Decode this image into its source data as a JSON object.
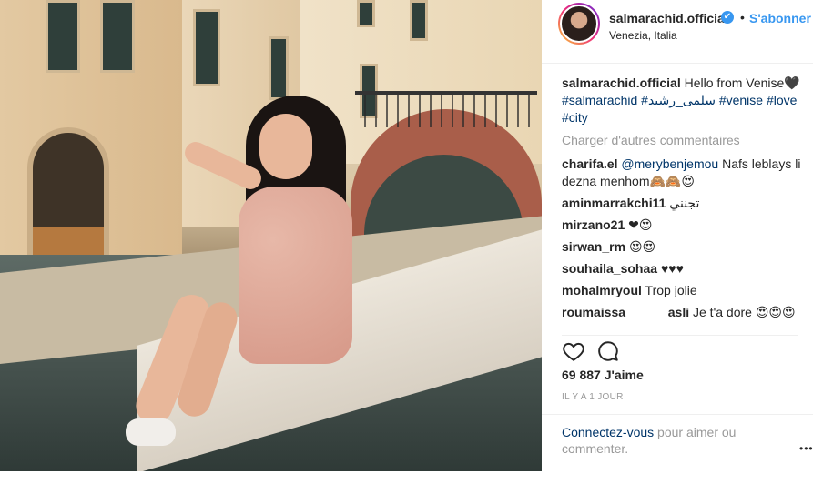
{
  "post": {
    "username": "salmarachid.official",
    "verified_glyph": "✔",
    "separator": "•",
    "follow_label": "S'abonner",
    "location": "Venezia, Italia"
  },
  "caption": {
    "username": "salmarachid.official",
    "text": "Hello from Venise",
    "emoji": "🖤",
    "hashtags": [
      "#salmarachid",
      "#سلمى_رشيد",
      "#venise",
      "#love",
      "#city"
    ]
  },
  "load_more_label": "Charger d'autres commentaires",
  "comments": [
    {
      "user": "charifa.el",
      "mention": "@merybenjemou",
      "text": "Nafs leblays li dezna menhom🙈🙈😍"
    },
    {
      "user": "aminmarrakchi11",
      "mention": "",
      "text": "تجنني"
    },
    {
      "user": "mirzano21",
      "mention": "",
      "text": "❤😍"
    },
    {
      "user": "sirwan_rm",
      "mention": "",
      "text": "😍😍"
    },
    {
      "user": "souhaila_sohaa",
      "mention": "",
      "text": "♥♥♥"
    },
    {
      "user": "mohalmryoul",
      "mention": "",
      "text": "Trop jolie"
    },
    {
      "user": "roumaissa______asli",
      "mention": "",
      "text": "Je t'a dore 😍😍😍"
    },
    {
      "user": "",
      "mention": "",
      "text": "😍😍"
    }
  ],
  "actions": {
    "like_icon": "heart-icon",
    "comment_icon": "comment-icon"
  },
  "likes": "69 887 J'aime",
  "timestamp": "IL Y A 1 JOUR",
  "footer": {
    "link": "Connectez-vous",
    "text": " pour aimer ou commenter.",
    "more": "•••"
  }
}
